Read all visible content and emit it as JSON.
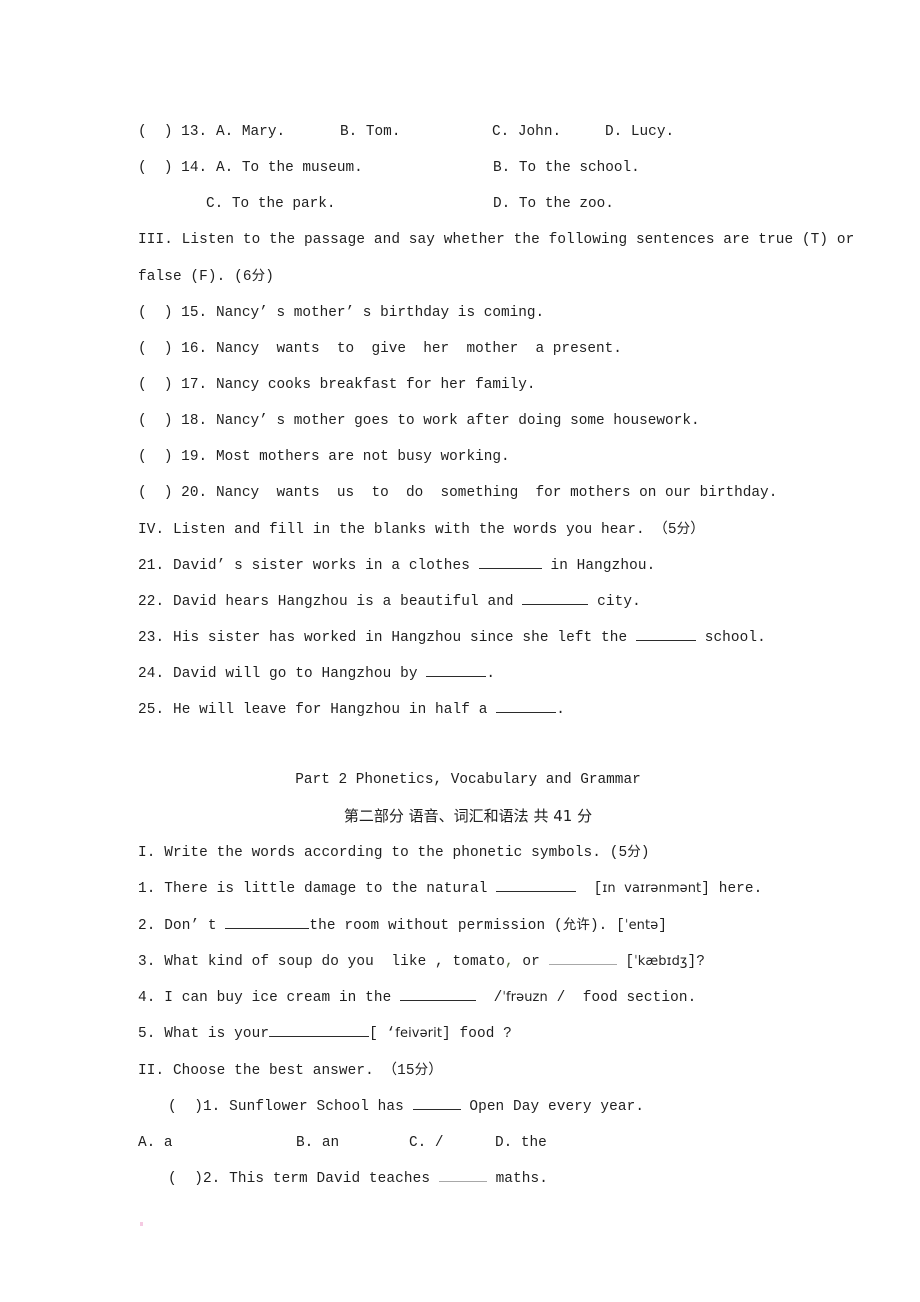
{
  "document": {
    "type": "scanned-exam-paper",
    "language": "en-zh",
    "page_background": "#ffffff",
    "text_color": "#1f1f1f"
  },
  "listening_section_tail": {
    "q13": {
      "marker": "(  ) 13.",
      "options": [
        "A. Mary.",
        "B. Tom.",
        "C. John.",
        "D. Lucy."
      ]
    },
    "q14": {
      "marker": "(  ) 14.",
      "options_row1": [
        "A. To the museum.",
        "B. To the school."
      ],
      "options_row2": [
        "C. To the park.",
        "D. To the zoo."
      ]
    }
  },
  "section_iii": {
    "heading_line1": "III. Listen to the passage and say whether the following sentences are true (T) or",
    "heading_line2_pre": "false (F). (6",
    "heading_line2_cn": "分",
    "heading_line2_post": ")",
    "items": [
      {
        "marker": "(  ) 15.",
        "text": "Nancy’ s mother’ s birthday is coming."
      },
      {
        "marker": "(  ) 16.",
        "text": "Nancy  wants  to  give  her  mother  a present."
      },
      {
        "marker": "(  ) 17.",
        "text": "Nancy cooks breakfast for her family."
      },
      {
        "marker": "(  ) 18.",
        "text": "Nancy’ s mother goes to work after doing some housework."
      },
      {
        "marker": "(  ) 19.",
        "text": "Most mothers are not busy working."
      },
      {
        "marker": "(  ) 20.",
        "text": "Nancy  wants  us  to  do  something  for mothers on our birthday."
      }
    ]
  },
  "section_iv": {
    "heading_pre": "IV. Listen and fill in the blanks with the words you hear. （5",
    "heading_cn": "分",
    "heading_post": "）",
    "items": [
      {
        "number": "21.",
        "before": "David’ s sister works in a clothes ",
        "after": " in Hangzhou."
      },
      {
        "number": "22.",
        "before": "David hears Hangzhou is a beautiful and ",
        "after": " city."
      },
      {
        "number": "23.",
        "before": "His sister has worked in Hangzhou since she left the ",
        "after": " school."
      },
      {
        "number": "24.",
        "before": "David will go to Hangzhou by ",
        "after": "."
      },
      {
        "number": "25.",
        "before": "He will leave for Hangzhou in half a ",
        "after": "."
      }
    ]
  },
  "part2": {
    "title_en": "Part 2 Phonetics, Vocabulary and Grammar",
    "title_cn": "第二部分 语音、词汇和语法 共 41 分"
  },
  "section_i_phonetics": {
    "heading_pre": "I. Write the words according to the phonetic symbols. (5",
    "heading_cn": "分",
    "heading_post": ")",
    "items": [
      {
        "number": "1.",
        "before": "There is little damage to the natural ",
        "after_pre": "  [",
        "ipa": "ɪn  vaɪrənmənt",
        "after_post": "] here."
      },
      {
        "number": "2.",
        "before": "Don’ t ",
        "after_pre": "the room without permission (",
        "cn": "允许",
        "after_mid": "). [",
        "ipa": "ˈentə",
        "after_post": "]"
      },
      {
        "number": "3.",
        "before": "What kind of soup do you  like , tomato",
        "comma": ",",
        "before2": " or ",
        "after_pre": " [",
        "ipa": "ˈkæbɪdʒ",
        "after_post": "]?"
      },
      {
        "number": "4.",
        "before": "I can buy ice cream in the ",
        "after_pre": "  /",
        "ipa": "ˈfrəuzn",
        "after_post": " /  food section."
      },
      {
        "number": "5.",
        "before": "What is your",
        "after_pre": "[ ‘",
        "ipa": "feivərit",
        "after_post": "] food ?"
      }
    ]
  },
  "section_ii_choose": {
    "heading_pre": "II. Choose the best answer. （15",
    "heading_cn": "分",
    "heading_post": "）",
    "q1": {
      "marker": "(  )1.",
      "before": " Sunflower School has ",
      "after": " Open Day every year.",
      "options": [
        "A. a",
        "B. an",
        "C. /",
        "D. the"
      ]
    },
    "q2": {
      "marker": "(  )2.",
      "before": " This term David teaches ",
      "after": " maths."
    }
  }
}
